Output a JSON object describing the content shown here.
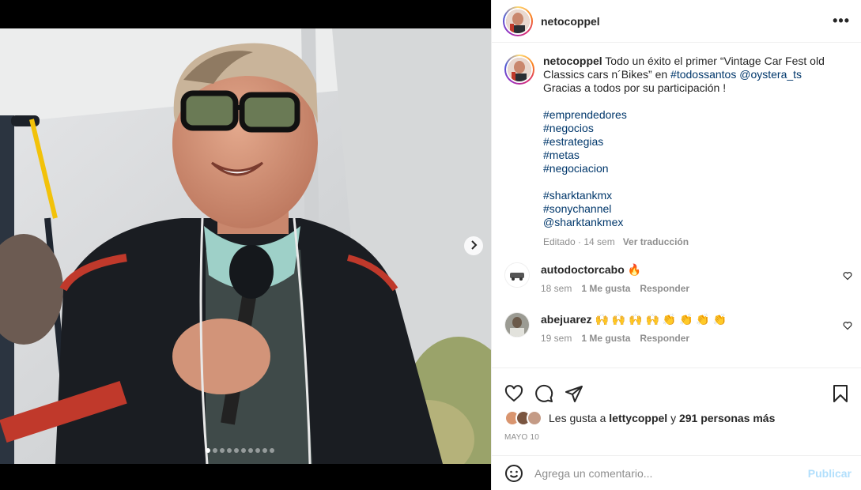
{
  "post": {
    "username": "netocoppel",
    "more_label": "•••"
  },
  "caption": {
    "username": "netocoppel",
    "text_1": " Todo un éxito el primer “Vintage Car Fest old Classics cars n´Bikes” en ",
    "tag_1": "#todossantos",
    "mention_1": "@oystera_ts",
    "text_2": " Gracias a todos por su participación !",
    "hashtags_a": [
      "#emprendedores",
      "#negocios",
      "#estrategias",
      "#metas",
      "#negociacion"
    ],
    "hashtags_b": [
      "#sharktankmx",
      "#sonychannel",
      "@sharktankmex"
    ],
    "edited": "Editado · 14 sem",
    "translate": "Ver traducción"
  },
  "comments": [
    {
      "username": "autodoctorcabo",
      "text": "🔥",
      "time": "18 sem",
      "likes": "1 Me gusta",
      "reply": "Responder"
    },
    {
      "username": "abejuarez",
      "text": "🙌 🙌 🙌 🙌 👏 👏 👏 👏",
      "time": "19 sem",
      "likes": "1 Me gusta",
      "reply": "Responder"
    }
  ],
  "likes": {
    "prefix": "Les gusta a ",
    "user": "lettycoppel",
    "middle": " y ",
    "count": "291 personas más"
  },
  "date": "MAYO 10",
  "add_comment": {
    "placeholder": "Agrega un comentario...",
    "publish": "Publicar"
  },
  "carousel": {
    "count": 10,
    "active": 0
  },
  "colors": {
    "link": "#00376b",
    "muted": "#8e8e8e",
    "publish": "#b2dffc"
  }
}
